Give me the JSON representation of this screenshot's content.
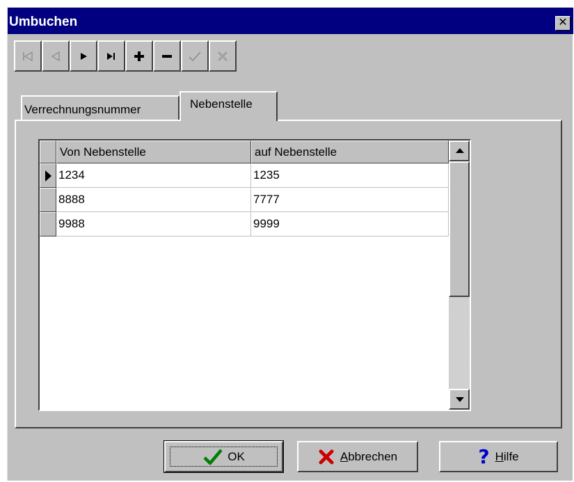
{
  "window": {
    "title": "Umbuchen",
    "close_glyph": "✕"
  },
  "navigator": {
    "buttons": [
      {
        "name": "first-record-button",
        "glyph": "⏮",
        "enabled": false
      },
      {
        "name": "prior-record-button",
        "glyph": "◁",
        "enabled": false
      },
      {
        "name": "next-record-button",
        "glyph": "▶",
        "enabled": true
      },
      {
        "name": "last-record-button",
        "glyph": "▶|",
        "enabled": true
      },
      {
        "name": "insert-record-button",
        "glyph": "+",
        "enabled": true
      },
      {
        "name": "delete-record-button",
        "glyph": "−",
        "enabled": true
      },
      {
        "name": "post-record-button",
        "glyph": "✓",
        "enabled": false
      },
      {
        "name": "cancel-edit-button",
        "glyph": "✕",
        "enabled": false
      }
    ]
  },
  "tabs": [
    {
      "label": "Verrechnungsnummer",
      "active": false
    },
    {
      "label": "Nebenstelle",
      "active": true
    }
  ],
  "grid": {
    "columns": [
      "Von Nebenstelle",
      "auf Nebenstelle"
    ],
    "rows": [
      {
        "von": "1234",
        "auf": "1235",
        "current": true
      },
      {
        "von": "8888",
        "auf": "7777",
        "current": false
      },
      {
        "von": "9988",
        "auf": "9999",
        "current": false
      }
    ]
  },
  "buttons": {
    "ok": {
      "label": "OK",
      "icon": "checkmark-icon",
      "icon_color": "#008000"
    },
    "cancel": {
      "label_u": "A",
      "label_rest": "bbrechen",
      "icon": "x-icon",
      "icon_color": "#cc0000"
    },
    "help": {
      "label_u": "H",
      "label_rest": "ilfe",
      "icon": "question-icon",
      "icon_color": "#0000cc"
    }
  },
  "colors": {
    "titlebar": "#000080",
    "face": "#c0c0c0"
  }
}
